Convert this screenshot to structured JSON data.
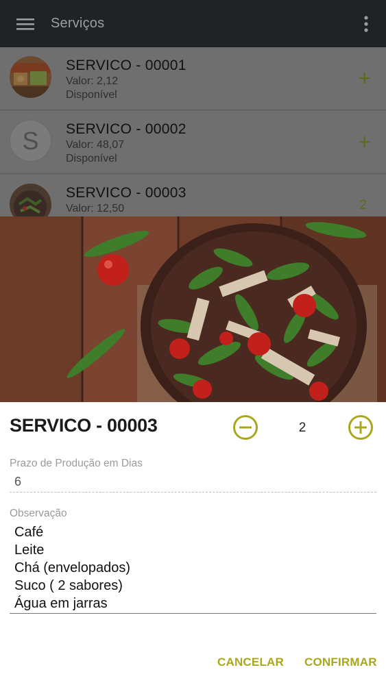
{
  "appbar": {
    "title": "Serviços"
  },
  "list": {
    "items": [
      {
        "title": "SERVICO - 00001",
        "valor": "Valor: 2,12",
        "status": "Disponível",
        "action": "+"
      },
      {
        "title": "SERVICO - 00002",
        "valor": "Valor: 48,07",
        "status": "Disponível",
        "action": "+",
        "avatar_letter": "S"
      },
      {
        "title": "SERVICO - 00003",
        "valor": "Valor: 12,50",
        "count": "2"
      }
    ]
  },
  "dialog": {
    "title": "SERVICO - 00003",
    "quantity": "2",
    "prazo_label": "Prazo de Produção em Dias",
    "prazo_value": "6",
    "obs_label": "Observação",
    "obs_lines": [
      "Café",
      "Leite",
      "Chá (envelopados)",
      "Suco ( 2 sabores)",
      "Água em jarras"
    ],
    "cancel_label": "CANCELAR",
    "confirm_label": "CONFIRMAR"
  },
  "colors": {
    "appbar": "#1f2326",
    "accent": "#a8a71e",
    "scrim_list": "#6f6f6f"
  },
  "icons": {
    "menu": "hamburger-icon",
    "more": "more-vert-icon",
    "minus": "minus-circle-icon",
    "plus": "plus-circle-icon"
  }
}
